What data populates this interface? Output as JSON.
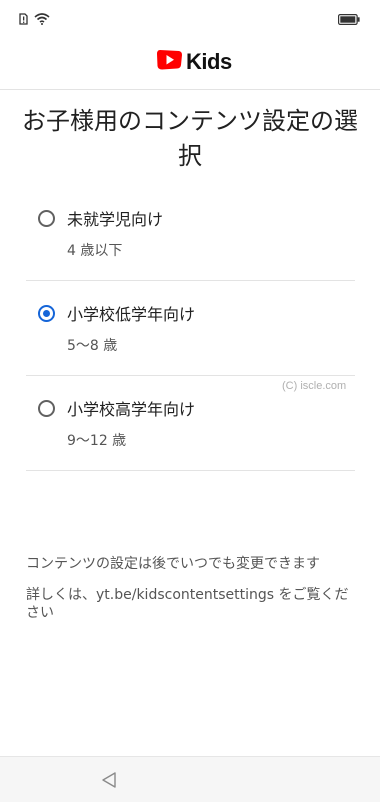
{
  "status_bar": {
    "icons": [
      "sim-alert-icon",
      "wifi-icon",
      "battery-icon"
    ]
  },
  "header": {
    "logo_icon": "youtube-play-icon",
    "logo_text": "Kids",
    "brand_color": "#ff0000"
  },
  "title": "お子様用のコンテンツ設定の選択",
  "options": [
    {
      "label": "未就学児向け",
      "age": "4 歳以下",
      "selected": false
    },
    {
      "label": "小学校低学年向け",
      "age": "5〜8 歳",
      "selected": true
    },
    {
      "label": "小学校高学年向け",
      "age": "9〜12 歳",
      "selected": false
    }
  ],
  "watermark": "(C) iscle.com",
  "notes": {
    "change_later": "コンテンツの設定は後でいつでも変更できます",
    "details": "詳しくは、yt.be/kidscontentsettings をご覧ください"
  },
  "colors": {
    "accent": "#1565d8",
    "divider": "#e3e3e3"
  },
  "nav": {
    "back_icon": "triangle-back-icon"
  }
}
